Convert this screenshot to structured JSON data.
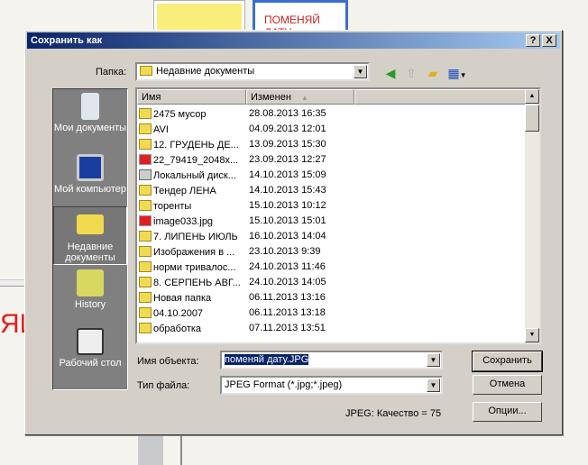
{
  "background": {
    "card_text": "ПОМЕНЯЙ ДАТУ",
    "partial_text": "ЯЙ"
  },
  "dialog": {
    "title": "Сохранить как",
    "help_label": "?",
    "close_label": "X",
    "folder_label": "Папка:",
    "folder_value": "Недавние документы",
    "toolbar": [
      "back-icon",
      "up-folder-icon",
      "new-folder-icon",
      "view-menu-icon"
    ],
    "places": [
      {
        "label": "Мои документы",
        "icon": "my-documents-icon"
      },
      {
        "label": "Мой компьютер",
        "icon": "my-computer-icon"
      },
      {
        "label": "Недавние документы",
        "icon": "recent-documents-icon",
        "selected": true
      },
      {
        "label": "History",
        "icon": "history-icon"
      },
      {
        "label": "Рабочий стол",
        "icon": "desktop-icon"
      }
    ],
    "columns": [
      "Имя",
      "Изменен",
      ""
    ],
    "sort_indicator": "▲",
    "files": [
      {
        "name": "2475 мусор",
        "date": "28.08.2013 16:35",
        "type": "folder"
      },
      {
        "name": "AVI",
        "date": "04.09.2013 12:01",
        "type": "folder"
      },
      {
        "name": "12. ГРУДЕНЬ ДЕ...",
        "date": "13.09.2013 15:30",
        "type": "folder"
      },
      {
        "name": "22_79419_2048x...",
        "date": "23.09.2013 12:27",
        "type": "jpg"
      },
      {
        "name": "Локальный диск...",
        "date": "14.10.2013 15:09",
        "type": "drive"
      },
      {
        "name": "Тендер ЛЕНА",
        "date": "14.10.2013 15:43",
        "type": "folder"
      },
      {
        "name": "торенты",
        "date": "15.10.2013 10:12",
        "type": "folder"
      },
      {
        "name": "image033.jpg",
        "date": "15.10.2013 15:01",
        "type": "jpg"
      },
      {
        "name": "7. ЛИПЕНЬ ИЮЛЬ",
        "date": "16.10.2013 14:04",
        "type": "folder"
      },
      {
        "name": "Изображения в ...",
        "date": "23.10.2013 9:39",
        "type": "folder"
      },
      {
        "name": "норми тривалос...",
        "date": "24.10.2013 11:46",
        "type": "folder"
      },
      {
        "name": "8. СЕРПЕНЬ АВГ...",
        "date": "24.10.2013 14:05",
        "type": "folder"
      },
      {
        "name": "Новая папка",
        "date": "06.11.2013 13:16",
        "type": "folder"
      },
      {
        "name": "04.10.2007",
        "date": "06.11.2013 13:18",
        "type": "folder"
      },
      {
        "name": "обработка",
        "date": "07.11.2013 13:51",
        "type": "folder"
      }
    ],
    "filename_label": "Имя объекта:",
    "filename_value": "поменяй дату.JPG",
    "filetype_label": "Тип файла:",
    "filetype_value": "JPEG Format (*.jpg;*.jpeg)",
    "quality_text": "JPEG: Качество = 75",
    "save_label": "Сохранить",
    "cancel_label": "Отмена",
    "options_label": "Опции..."
  }
}
